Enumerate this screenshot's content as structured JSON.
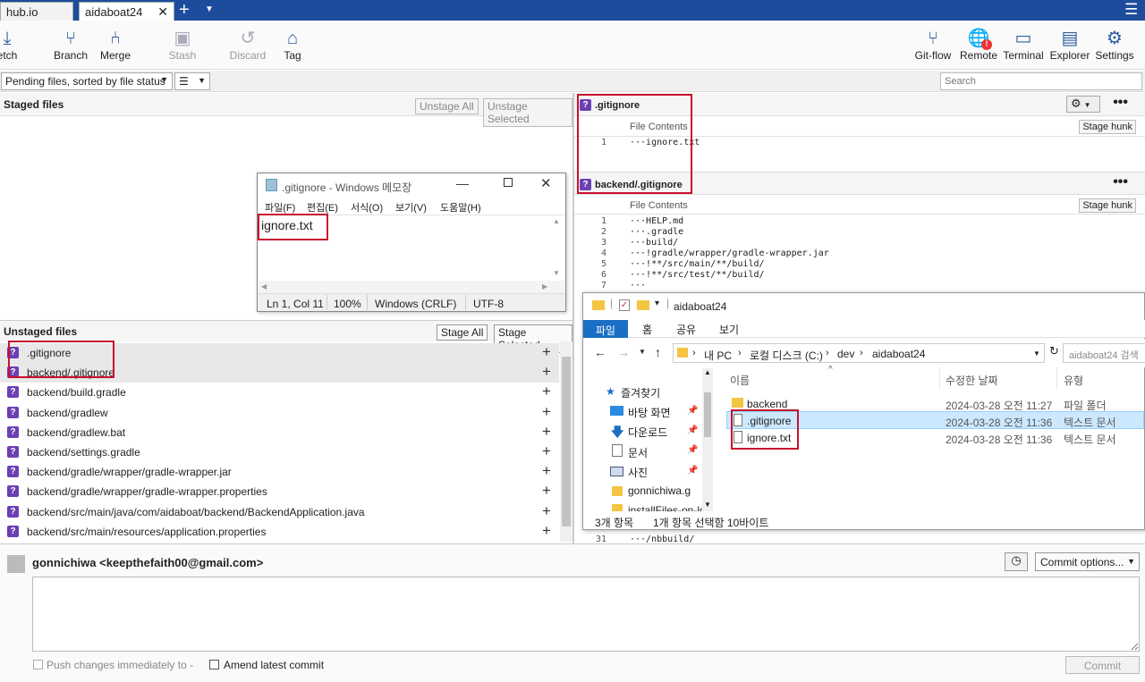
{
  "tabs": [
    {
      "label": "hub.io"
    },
    {
      "label": "aidaboat24"
    }
  ],
  "toolbar": {
    "fetch": "etch",
    "branch": "Branch",
    "merge": "Merge",
    "stash": "Stash",
    "discard": "Discard",
    "tag": "Tag",
    "gitflow": "Git-flow",
    "remote": "Remote",
    "terminal": "Terminal",
    "explorer": "Explorer",
    "settings": "Settings"
  },
  "filter": {
    "sort_label": "Pending files, sorted by file status",
    "search_placeholder": "Search"
  },
  "staged": {
    "title": "Staged files",
    "unstage_all": "Unstage All",
    "unstage_selected": "Unstage Selected"
  },
  "unstaged": {
    "title": "Unstaged files",
    "stage_all": "Stage All",
    "stage_selected": "Stage Selected",
    "files": [
      ".gitignore",
      "backend/.gitignore",
      "backend/build.gradle",
      "backend/gradlew",
      "backend/gradlew.bat",
      "backend/settings.gradle",
      "backend/gradle/wrapper/gradle-wrapper.jar",
      "backend/gradle/wrapper/gradle-wrapper.properties",
      "backend/src/main/java/com/aidaboat/backend/BackendApplication.java",
      "backend/src/main/resources/application.properties"
    ]
  },
  "diff": {
    "file1": {
      "name": ".gitignore",
      "label": "File Contents",
      "hunk": "Stage hunk",
      "lines": [
        {
          "n": "1",
          "t": "···ignore.txt"
        }
      ]
    },
    "file2": {
      "name": "backend/.gitignore",
      "label": "File Contents",
      "hunk": "Stage hunk",
      "lines": [
        {
          "n": "1",
          "t": "···HELP.md"
        },
        {
          "n": "2",
          "t": "···.gradle"
        },
        {
          "n": "3",
          "t": "···build/"
        },
        {
          "n": "4",
          "t": "···!gradle/wrapper/gradle-wrapper.jar"
        },
        {
          "n": "5",
          "t": "···!**/src/main/**/build/"
        },
        {
          "n": "6",
          "t": "···!**/src/test/**/build/"
        },
        {
          "n": "7",
          "t": "···"
        }
      ],
      "tail": [
        {
          "n": "31",
          "t": "···/nbbuild/"
        }
      ]
    }
  },
  "commit": {
    "author": "gonnichiwa <keepthefaith00@gmail.com>",
    "options": "Commit options...",
    "push_label": "Push changes immediately to -",
    "amend_label": "Amend latest commit",
    "commit_btn": "Commit"
  },
  "notepad": {
    "title": ".gitignore - Windows 메모장",
    "menu": [
      "파일(F)",
      "편집(E)",
      "서식(O)",
      "보기(V)",
      "도움말(H)"
    ],
    "content": "ignore.txt",
    "status": {
      "pos": "Ln 1, Col 11",
      "zoom": "100%",
      "eol": "Windows (CRLF)",
      "enc": "UTF-8"
    }
  },
  "explorer": {
    "title": "aidaboat24",
    "ribbon": [
      "파일",
      "홈",
      "공유",
      "보기"
    ],
    "path": [
      "내 PC",
      "로컬 디스크 (C:)",
      "dev",
      "aidaboat24"
    ],
    "search": "aidaboat24 검색",
    "cols": {
      "name": "이름",
      "date": "수정한 날짜",
      "type": "유형"
    },
    "nav": [
      "즐겨찾기",
      "바탕 화면",
      "다운로드",
      "문서",
      "사진",
      "gonnichiwa.g",
      "installFiles-on-lo"
    ],
    "files": [
      {
        "name": "backend",
        "date": "2024-03-28 오전 11:27",
        "type": "파일 폴더"
      },
      {
        "name": ".gitignore",
        "date": "2024-03-28 오전 11:36",
        "type": "텍스트 문서"
      },
      {
        "name": "ignore.txt",
        "date": "2024-03-28 오전 11:36",
        "type": "텍스트 문서"
      }
    ],
    "status": {
      "count": "3개 항목",
      "selected": "1개 항목 선택함 10바이트"
    }
  },
  "colors": {
    "tabbar": "#1d4c9c",
    "git_unknown": "#6c3fb4",
    "annotation": "#c8102e",
    "explorer_accent": "#1a6fc4",
    "selected_row": "#cce8ff"
  }
}
